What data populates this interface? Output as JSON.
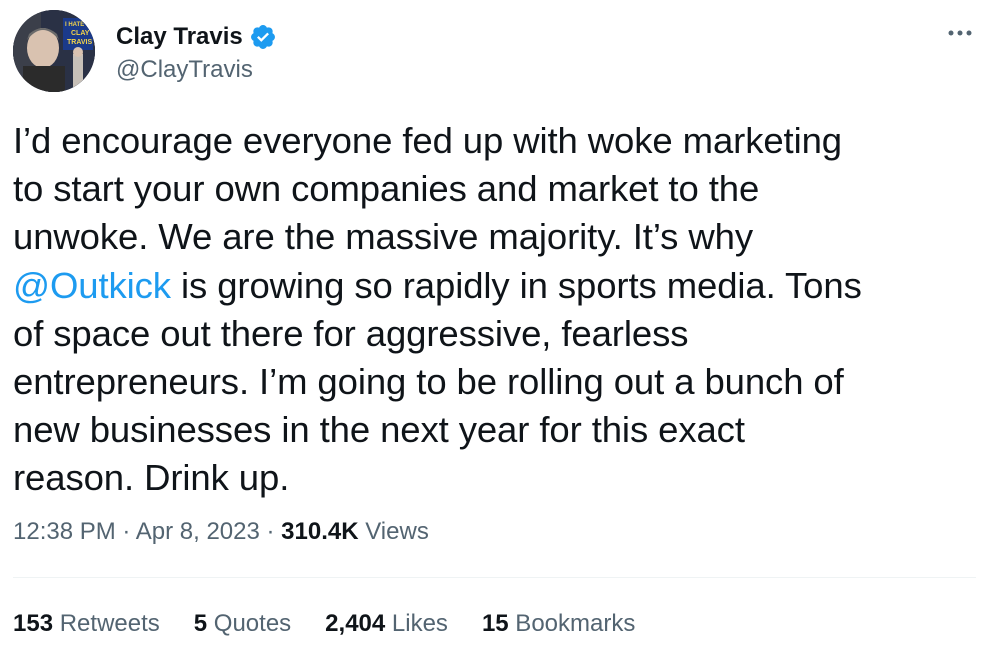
{
  "author": {
    "display_name": "Clay Travis",
    "handle": "@ClayTravis",
    "verified": true,
    "avatar_sign_text": "I HATE YOU CLAY TRAVIS"
  },
  "tweet": {
    "text_before_mention": "I’d encourage everyone fed up with woke marketing\nto start your own companies and market to the\nunwoke. We are the massive majority. It’s why\n",
    "mention": "@Outkick",
    "text_after_mention": " is growing so rapidly in sports media. Tons\nof space out there for aggressive, fearless\nentrepreneurs. I’m going to be rolling out a bunch of\nnew businesses in the next year for this exact\nreason. Drink up."
  },
  "meta": {
    "time": "12:38 PM",
    "separator": " · ",
    "date": "Apr 8, 2023",
    "views_count": "310.4K",
    "views_label": " Views"
  },
  "stats": {
    "retweets": {
      "count": "153",
      "label": " Retweets"
    },
    "quotes": {
      "count": "5",
      "label": " Quotes"
    },
    "likes": {
      "count": "2,404",
      "label": " Likes"
    },
    "bookmarks": {
      "count": "15",
      "label": " Bookmarks"
    }
  },
  "colors": {
    "link": "#1d9bf0",
    "secondary_text": "#536471",
    "primary_text": "#0f1419",
    "verified_badge": "#1d9bf0"
  },
  "icons": {
    "more": "more-dots-icon",
    "verified": "verified-badge-icon"
  }
}
